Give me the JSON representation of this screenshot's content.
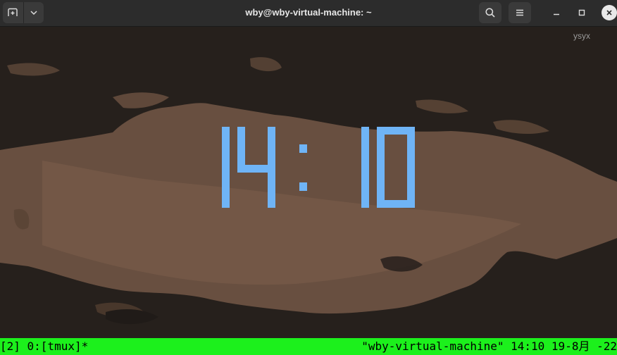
{
  "window": {
    "title": "wby@wby-virtual-machine: ~",
    "new_tab_icon": "new-tab-icon",
    "dropdown_icon": "chevron-down-icon",
    "search_icon": "search-icon",
    "menu_icon": "hamburger-menu-icon",
    "minimize_icon": "minimize-icon",
    "maximize_icon": "maximize-icon",
    "close_icon": "close-icon"
  },
  "terminal": {
    "session_name": "ysyx",
    "clock": {
      "time": "14:10",
      "color": "#6fb4f6"
    }
  },
  "status_bar": {
    "left": "[2] 0:[tmux]*",
    "right": "\"wby-virtual-machine\" 14:10 19-8月 -22",
    "background": "#1cf01c"
  }
}
